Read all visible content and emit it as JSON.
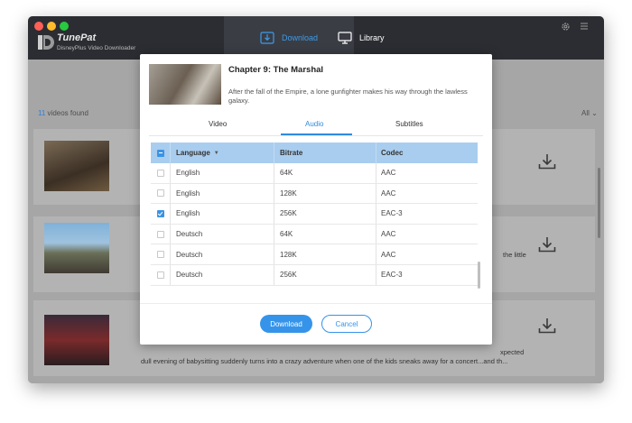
{
  "app": {
    "name": "TunePat",
    "subtitle": "DisneyPlus Video Downloader"
  },
  "nav": {
    "download_label": "Download",
    "library_label": "Library"
  },
  "list": {
    "count": "11",
    "count_suffix": "videos found",
    "filter": "All",
    "row2_tail": "the little",
    "row3_tail1": "xpected",
    "row3_tail2": "dull evening of babysitting suddenly turns into a crazy adventure when one of the kids sneaks away for a concert...and th..."
  },
  "dialog": {
    "title": "Chapter 9: The Marshal",
    "description": "After the fall of the Empire, a lone gunfighter makes his way through the lawless galaxy.",
    "tabs": [
      "Video",
      "Audio",
      "Subtitles"
    ],
    "active_tab": "Audio",
    "columns": {
      "language": "Language",
      "bitrate": "Bitrate",
      "codec": "Codec"
    },
    "rows": [
      {
        "language": "English",
        "bitrate": "64K",
        "codec": "AAC",
        "checked": false
      },
      {
        "language": "English",
        "bitrate": "128K",
        "codec": "AAC",
        "checked": false
      },
      {
        "language": "English",
        "bitrate": "256K",
        "codec": "EAC-3",
        "checked": true
      },
      {
        "language": "Deutsch",
        "bitrate": "64K",
        "codec": "AAC",
        "checked": false
      },
      {
        "language": "Deutsch",
        "bitrate": "128K",
        "codec": "AAC",
        "checked": false
      },
      {
        "language": "Deutsch",
        "bitrate": "256K",
        "codec": "EAC-3",
        "checked": false
      }
    ],
    "download_button": "Download",
    "cancel_button": "Cancel"
  },
  "colors": {
    "accent": "#3594ea",
    "titlebar": "#2b2d32",
    "header_row": "#a9cdee"
  }
}
